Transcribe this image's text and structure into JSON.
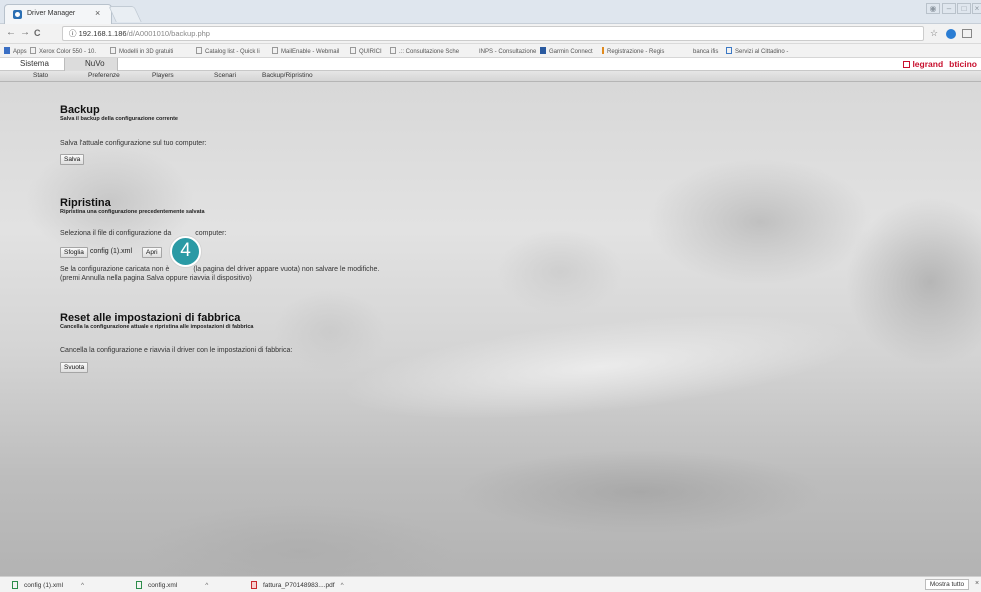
{
  "browser": {
    "tab_title": "Driver Manager",
    "tab_close": "×",
    "url_host": "192.168.1.186",
    "url_path": "/d/A0001010/backup.php",
    "url_info": "ⓘ",
    "back": "←",
    "forward": "→",
    "reload": "C",
    "bookmark_star": "☆",
    "bookmarks": [
      "Apps",
      "Xerox Color 550 - 10.",
      "Modelli in 3D gratuiti",
      "Catalog list - Quick li",
      "MailEnable - Webmail",
      "QUIRICI",
      ".:: Consultazione Sche",
      "INPS - Consultazione",
      "Garmin Connect",
      "Registrazione - Regis",
      "banca ifis",
      "Servizi al Cittadino -"
    ]
  },
  "app": {
    "top_menu": [
      "Sistema",
      "NuVo"
    ],
    "logo": {
      "legrand": "legrand",
      "bticino": "bticino"
    },
    "sub_menu": [
      "Stato",
      "Preferenze",
      "Players",
      "Scenari",
      "Backup/Ripristino"
    ]
  },
  "backup": {
    "title": "Backup",
    "subtitle": "Salva il backup della configurazione corrente",
    "text": "Salva l'attuale configurazione sul tuo computer:",
    "button": "Salva"
  },
  "restore": {
    "title": "Ripristina",
    "subtitle": "Ripristina una configurazione precedentemente salvata",
    "text_before": "Seleziona il file di configurazione da",
    "text_after": "computer:",
    "browse_button": "Sfoglia",
    "filename": "config (1).xml",
    "open_button": "Apri",
    "warning_1a": "Se la configurazione caricata non è",
    "warning_1b": "(la pagina del driver appare vuota) non salvare le modifiche.",
    "warning_2a": "(premi Annulla nella pagina Salva oppure riavvia il dispositivo)"
  },
  "reset": {
    "title": "Reset alle impostazioni di fabbrica",
    "subtitle": "Cancella la configurazione attuale e ripristina alle impostazioni di fabbrica",
    "text": "Cancella la configurazione e riavvia il driver con le impostazioni di fabbrica:",
    "button": "Svuota"
  },
  "step_marker": "4",
  "downloads": {
    "items": [
      "config (1).xml",
      "config.xml",
      "fattura_P70148983....pdf"
    ],
    "caret": "^",
    "show_all": "Mostra tutto",
    "close": "×"
  }
}
